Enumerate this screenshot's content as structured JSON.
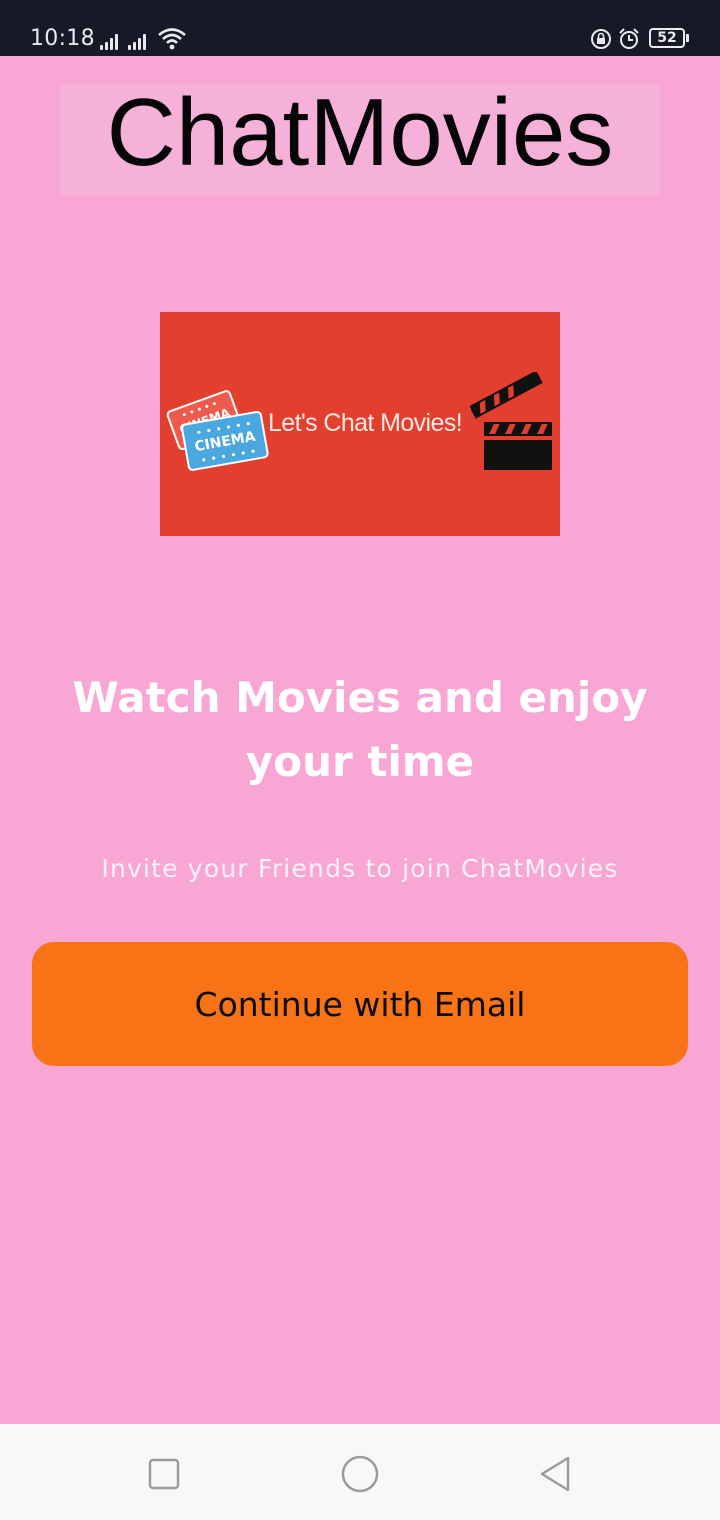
{
  "status_bar": {
    "time": "10:18",
    "battery": "52",
    "icons": [
      "signal-icon",
      "signal-icon",
      "wifi-icon",
      "lock-rotation-icon",
      "alarm-icon",
      "battery-icon"
    ]
  },
  "logo": {
    "text": "ChatMovies"
  },
  "banner": {
    "text": "Let's Chat Movies!",
    "ticket_label": "CINEMA",
    "background": "#e23f2e"
  },
  "main": {
    "headline": "Watch Movies and enjoy your time",
    "subline": "Invite your Friends to join ChatMovies",
    "continue_button": "Continue with Email"
  },
  "colors": {
    "background": "#f8a6d4",
    "button": "#f87216",
    "status_bar": "#171a26"
  },
  "nav_bar": {
    "buttons": [
      "recents-icon",
      "home-icon",
      "back-icon"
    ]
  }
}
